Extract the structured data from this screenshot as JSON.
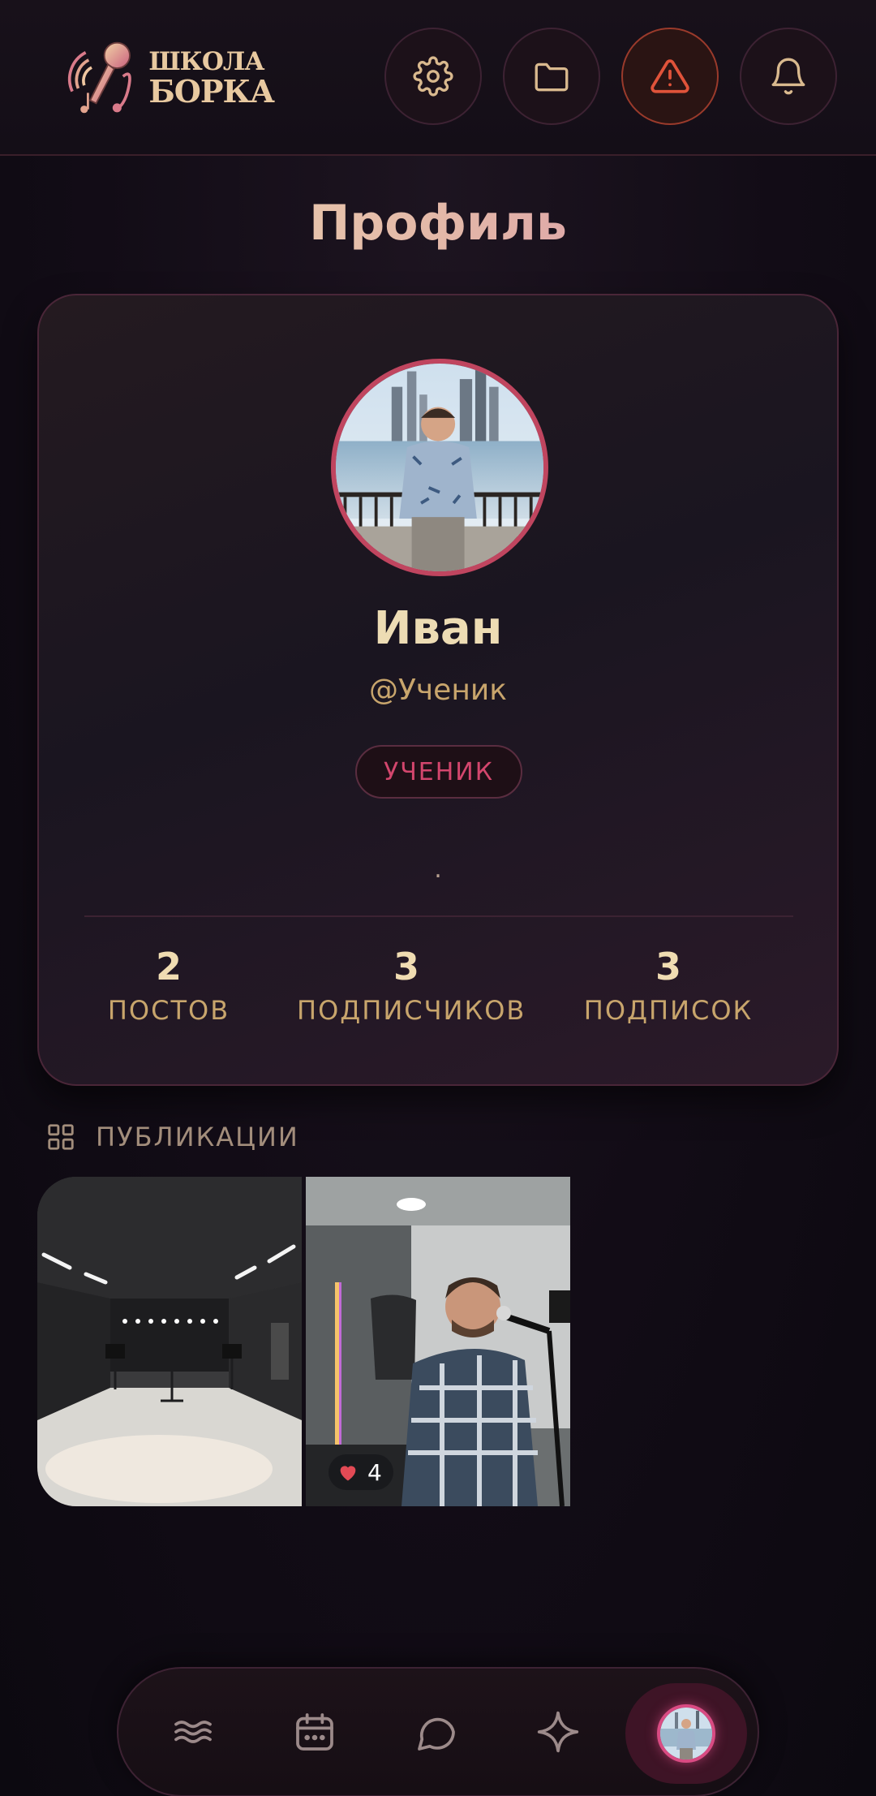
{
  "app": {
    "logo_line1": "ШКОЛА",
    "logo_line2": "БОРКА"
  },
  "header": {
    "buttons": [
      {
        "icon": "gear-icon"
      },
      {
        "icon": "folder-icon"
      },
      {
        "icon": "warning-icon",
        "color": "#e0533a"
      },
      {
        "icon": "bell-icon"
      }
    ]
  },
  "page": {
    "title": "Профиль"
  },
  "profile": {
    "name": "Иван",
    "username": "@Ученик",
    "role": "УЧЕНИК",
    "bio": ".",
    "stats": [
      {
        "value": "2",
        "label": "ПОСТОВ"
      },
      {
        "value": "3",
        "label": "ПОДПИСЧИКОВ"
      },
      {
        "value": "3",
        "label": "ПОДПИСОК"
      }
    ]
  },
  "publications": {
    "header": "ПУБЛИКАЦИИ",
    "posts": [
      {
        "image": "studio-room-photo",
        "likes": null
      },
      {
        "image": "singer-at-microphone-photo",
        "likes": "4"
      }
    ]
  },
  "bottom_nav": {
    "items": [
      "waves-icon",
      "calendar-icon",
      "chat-icon",
      "sparkle-icon",
      "profile-avatar"
    ],
    "active": "profile-avatar"
  },
  "colors": {
    "accent_pink": "#d3466d",
    "gold": "#c8a56c",
    "cream": "#eddcb4",
    "background": "#120c16"
  }
}
